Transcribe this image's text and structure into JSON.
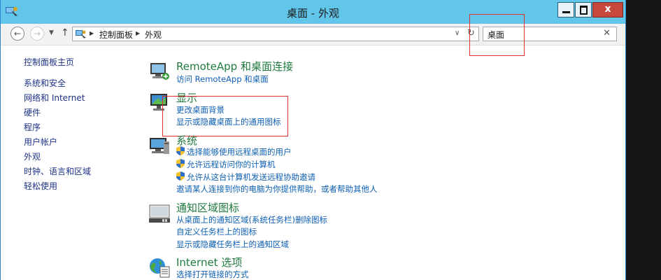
{
  "window": {
    "title": "桌面 - 外观"
  },
  "title_buttons": {
    "close_symbol": "x"
  },
  "address": {
    "crumbs": [
      "控制面板",
      "外观"
    ]
  },
  "search": {
    "value": "桌面",
    "clear_symbol": "✕"
  },
  "sidebar": {
    "home": "控制面板主页",
    "items": [
      "系统和安全",
      "网络和 Internet",
      "硬件",
      "程序",
      "用户帐户",
      "外观",
      "时钟、语言和区域",
      "轻松使用"
    ]
  },
  "sections": {
    "remoteapp": {
      "title": "RemoteApp 和桌面连接",
      "links": [
        "访问 RemoteApp 和桌面"
      ]
    },
    "display": {
      "title": "显示",
      "links": [
        "更改桌面背景",
        "显示或隐藏桌面上的通用图标"
      ]
    },
    "system": {
      "title": "系统",
      "links": [
        "选择能够使用远程桌面的用户",
        "允许远程访问你的计算机",
        "允许从这台计算机发送远程协助邀请",
        "邀请某人连接到你的电脑为你提供帮助，或者帮助其他人"
      ]
    },
    "notification": {
      "title": "通知区域图标",
      "links": [
        "从桌面上的通知区域(系统任务栏)删除图标",
        "自定义任务栏上的图标",
        "显示或隐藏任务栏上的通知区域"
      ]
    },
    "internet": {
      "title": "Internet 选项",
      "links": [
        "选择打开链接的方式"
      ]
    }
  },
  "colors": {
    "titlebar": "#62c5ea",
    "section_title": "#1f7a3e",
    "link": "#0d5fb3",
    "highlight": "#e03030"
  }
}
